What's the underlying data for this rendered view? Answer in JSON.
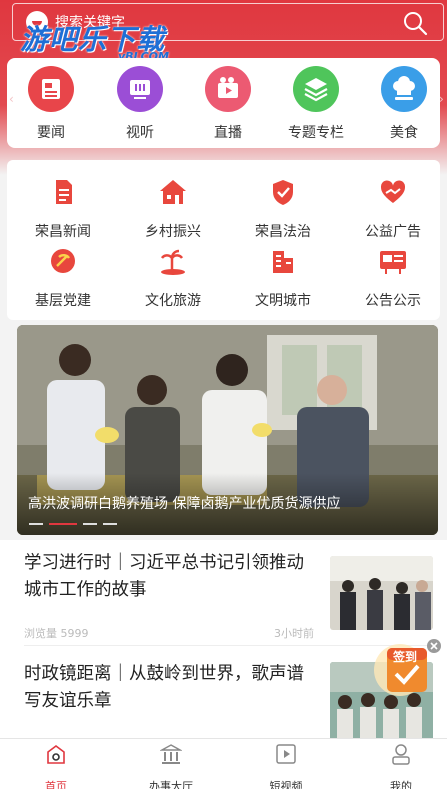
{
  "search": {
    "placeholder": "搜索关键字"
  },
  "watermark": {
    "title": "游吧乐下载",
    "sub": "yBLCOM"
  },
  "categories": [
    {
      "label": "要闻",
      "icon": "news-icon",
      "color": "#e8454a"
    },
    {
      "label": "视听",
      "icon": "tv-icon",
      "color": "#9b4ed6"
    },
    {
      "label": "直播",
      "icon": "video-camera-icon",
      "color": "#ec5a72"
    },
    {
      "label": "专题专栏",
      "icon": "layers-icon",
      "color": "#4fc55b"
    },
    {
      "label": "美食",
      "icon": "chef-hat-icon",
      "color": "#3a9ee8"
    }
  ],
  "services": [
    {
      "label": "荣昌新闻",
      "icon": "document-icon"
    },
    {
      "label": "乡村振兴",
      "icon": "village-house-icon"
    },
    {
      "label": "荣昌法治",
      "icon": "shield-check-icon"
    },
    {
      "label": "公益广告",
      "icon": "heart-hand-icon"
    },
    {
      "label": "基层党建",
      "icon": "party-emblem-icon"
    },
    {
      "label": "文化旅游",
      "icon": "palm-island-icon"
    },
    {
      "label": "文明城市",
      "icon": "buildings-icon"
    },
    {
      "label": "公告公示",
      "icon": "bulletin-board-icon"
    }
  ],
  "banner": {
    "caption": "高洪波调研白鹅养殖场 保障卤鹅产业优质货源供应"
  },
  "news": [
    {
      "title": "学习进行时｜习近平总书记引领推动城市工作的故事",
      "views_label": "浏览量",
      "views": "5999",
      "time": "3小时前"
    },
    {
      "title": "时政镜距离｜从鼓岭到世界，歌声谱写友谊乐章"
    }
  ],
  "float_badge": {
    "label": "签到"
  },
  "tabs": [
    {
      "label": "首页",
      "icon": "home-icon"
    },
    {
      "label": "办事大厅",
      "icon": "government-building-icon"
    },
    {
      "label": "短视频",
      "icon": "play-icon"
    },
    {
      "label": "我的",
      "icon": "user-icon"
    }
  ],
  "colors": {
    "brand": "#e0373f",
    "service_icon": "#e8473d"
  }
}
